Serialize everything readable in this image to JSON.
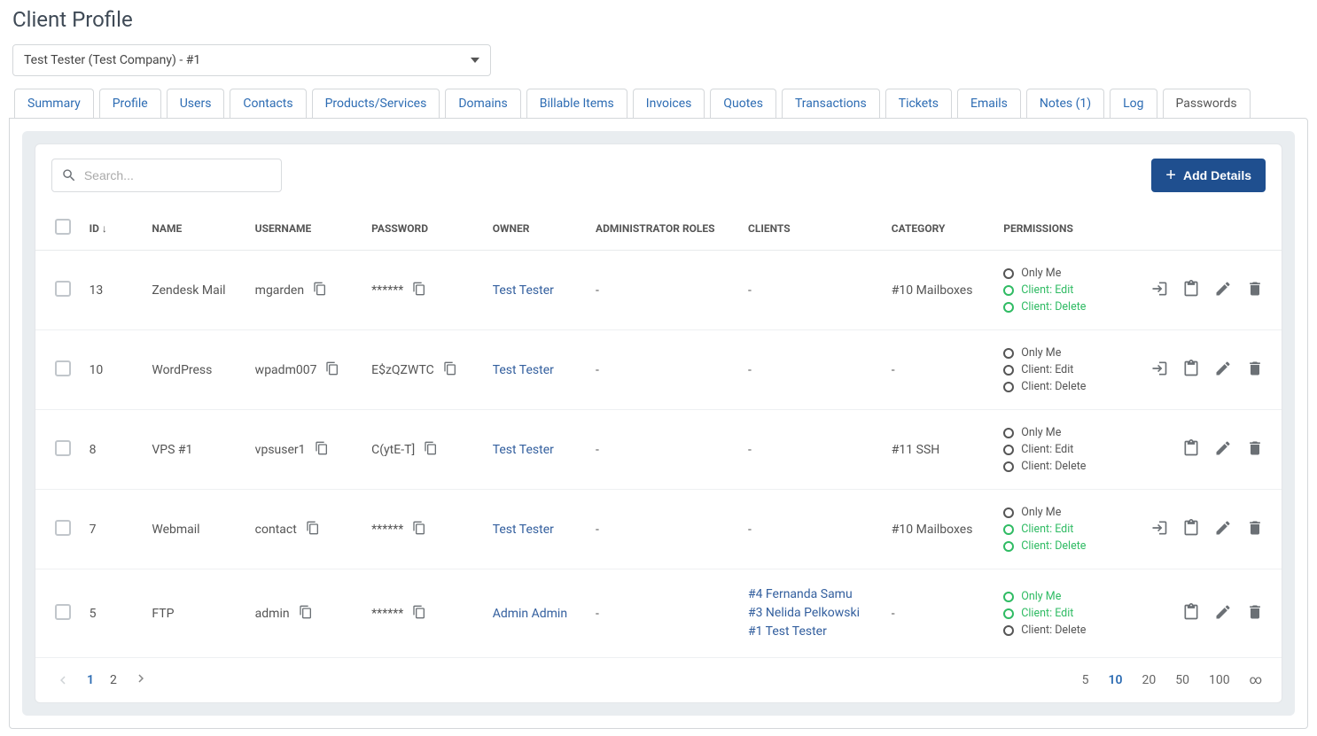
{
  "page_title": "Client Profile",
  "client_selector": {
    "value": "Test Tester (Test Company) - #1"
  },
  "tabs": [
    "Summary",
    "Profile",
    "Users",
    "Contacts",
    "Products/Services",
    "Domains",
    "Billable Items",
    "Invoices",
    "Quotes",
    "Transactions",
    "Tickets",
    "Emails",
    "Notes (1)",
    "Log",
    "Passwords"
  ],
  "active_tab_index": 14,
  "search": {
    "placeholder": "Search..."
  },
  "add_button_label": "Add Details",
  "columns": {
    "id": "ID",
    "name": "NAME",
    "username": "USERNAME",
    "password": "PASSWORD",
    "owner": "OWNER",
    "roles": "ADMINISTRATOR ROLES",
    "clients": "CLIENTS",
    "category": "CATEGORY",
    "permissions": "PERMISSIONS"
  },
  "sort_indicator": "↓",
  "rows": [
    {
      "id": "13",
      "name": "Zendesk Mail",
      "username": "mgarden",
      "password": "******",
      "owner": "Test Tester",
      "roles": "-",
      "clients": [
        "-"
      ],
      "category": "#10 Mailboxes",
      "permissions": [
        {
          "label": "Only Me",
          "style": "normal"
        },
        {
          "label": "Client: Edit",
          "style": "green"
        },
        {
          "label": "Client: Delete",
          "style": "green"
        }
      ],
      "actions": [
        "login",
        "clipboard",
        "edit",
        "delete"
      ]
    },
    {
      "id": "10",
      "name": "WordPress",
      "username": "wpadm007",
      "password": "E$zQZWTC",
      "owner": "Test Tester",
      "roles": "-",
      "clients": [
        "-"
      ],
      "category": "-",
      "permissions": [
        {
          "label": "Only Me",
          "style": "normal"
        },
        {
          "label": "Client: Edit",
          "style": "normal"
        },
        {
          "label": "Client: Delete",
          "style": "normal"
        }
      ],
      "actions": [
        "login",
        "clipboard",
        "edit",
        "delete"
      ]
    },
    {
      "id": "8",
      "name": "VPS #1",
      "username": "vpsuser1",
      "password": "C(ytE-T]",
      "owner": "Test Tester",
      "roles": "-",
      "clients": [
        "-"
      ],
      "category": "#11 SSH",
      "permissions": [
        {
          "label": "Only Me",
          "style": "normal"
        },
        {
          "label": "Client: Edit",
          "style": "normal"
        },
        {
          "label": "Client: Delete",
          "style": "normal"
        }
      ],
      "actions": [
        "clipboard",
        "edit",
        "delete"
      ]
    },
    {
      "id": "7",
      "name": "Webmail",
      "username": "contact",
      "password": "******",
      "owner": "Test Tester",
      "roles": "-",
      "clients": [
        "-"
      ],
      "category": "#10 Mailboxes",
      "permissions": [
        {
          "label": "Only Me",
          "style": "normal"
        },
        {
          "label": "Client: Edit",
          "style": "green"
        },
        {
          "label": "Client: Delete",
          "style": "green"
        }
      ],
      "actions": [
        "login",
        "clipboard",
        "edit",
        "delete"
      ]
    },
    {
      "id": "5",
      "name": "FTP",
      "username": "admin",
      "password": "******",
      "owner": "Admin Admin",
      "roles": "-",
      "clients": [
        "#4 Fernanda Samu",
        "#3 Nelida Pelkowski",
        "#1 Test Tester"
      ],
      "category": "-",
      "permissions": [
        {
          "label": "Only Me",
          "style": "green"
        },
        {
          "label": "Client: Edit",
          "style": "green"
        },
        {
          "label": "Client: Delete",
          "style": "normal"
        }
      ],
      "actions": [
        "clipboard",
        "edit",
        "delete"
      ]
    }
  ],
  "pagination": {
    "pages": [
      "1",
      "2"
    ],
    "current_page": "1",
    "page_sizes": [
      "5",
      "10",
      "20",
      "50",
      "100",
      "∞"
    ],
    "current_page_size": "10"
  }
}
